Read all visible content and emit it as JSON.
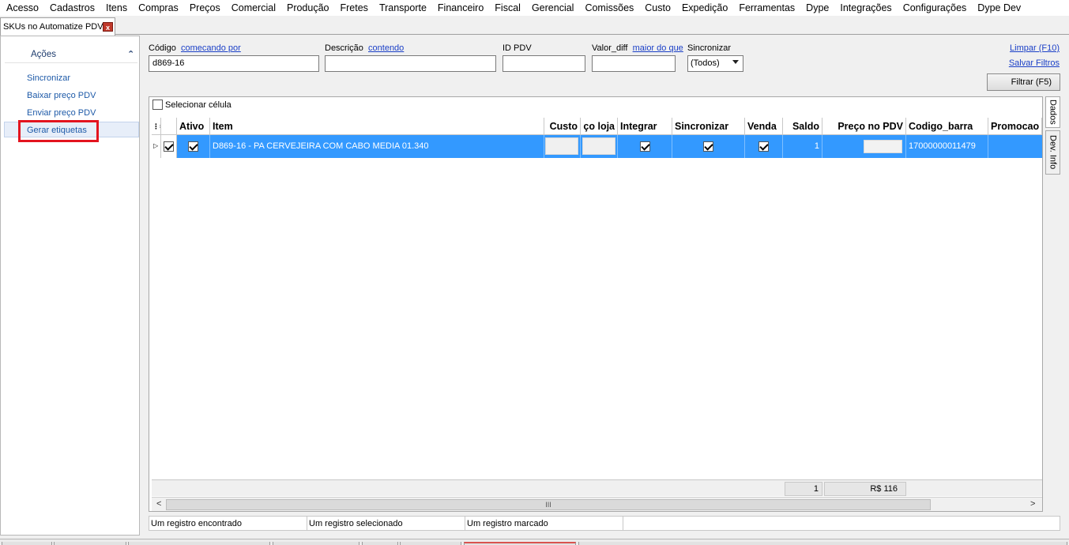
{
  "menu": [
    "Acesso",
    "Cadastros",
    "Itens",
    "Compras",
    "Preços",
    "Comercial",
    "Produção",
    "Fretes",
    "Transporte",
    "Financeiro",
    "Fiscal",
    "Gerencial",
    "Comissões",
    "Custo",
    "Expedição",
    "Ferramentas",
    "Dype",
    "Integrações",
    "Configurações",
    "Dype Dev"
  ],
  "tab": {
    "title": "SKUs no Automatize PDV",
    "close": "x"
  },
  "sidebar": {
    "header": "Ações",
    "items": [
      "Sincronizar",
      "Baixar preço PDV",
      "Enviar preço PDV",
      "Gerar etiquetas"
    ]
  },
  "filters": {
    "codigo": {
      "label": "Código",
      "mode": "comecando por",
      "value": "d869-16"
    },
    "descricao": {
      "label": "Descrição",
      "mode": "contendo",
      "value": ""
    },
    "idpdv": {
      "label": "ID PDV",
      "value": ""
    },
    "valordiff": {
      "label": "Valor_diff",
      "mode": "maior do que",
      "value": ""
    },
    "sincronizar": {
      "label": "Sincronizar",
      "value": "(Todos)"
    },
    "limpar": "Limpar (F10)",
    "salvar": "Salvar Filtros",
    "filtrar": "Filtrar (F5)"
  },
  "grid": {
    "select_cell": "Selecionar célula",
    "columns": [
      "Ativo",
      "Item",
      "Custo",
      "ço loja",
      "Integrar",
      "Sincronizar",
      "Venda",
      "Saldo",
      "Preço no PDV",
      "Codigo_barra",
      "Promocao"
    ],
    "row": {
      "item": "D869-16 - PA CERVEJEIRA COM CABO MEDIA 01.340",
      "saldo": "1",
      "codigo_barra": "17000000011479"
    },
    "footer": {
      "saldo_total": "1",
      "preco_total": "R$ 116"
    },
    "scroll_thumb": "III"
  },
  "side_tabs": [
    "Dados",
    "Dev. Info"
  ],
  "status": [
    "Um registro encontrado",
    "Um registro selecionado",
    "Um registro marcado"
  ]
}
